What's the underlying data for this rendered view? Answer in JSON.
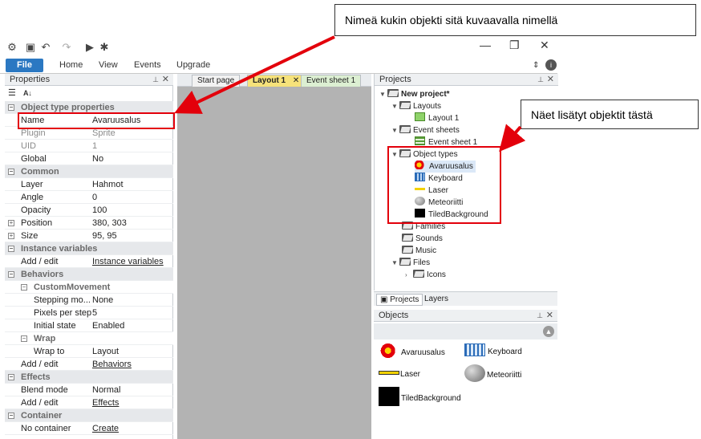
{
  "callouts": {
    "top": "Nimeä kukin objekti sitä kuvaavalla nimellä",
    "right": "Näet lisätyt objektit tästä"
  },
  "ribbon": {
    "file": "File",
    "home": "Home",
    "view": "View",
    "events": "Events",
    "upgrade": "Upgrade"
  },
  "properties": {
    "title": "Properties",
    "rows": [
      {
        "type": "cat",
        "label": "Object type properties"
      },
      {
        "label": "Name",
        "value": "Avaruusalus"
      },
      {
        "label": "Plugin",
        "value": "Sprite",
        "dim": true
      },
      {
        "label": "UID",
        "value": "1",
        "dim": true
      },
      {
        "label": "Global",
        "value": "No"
      },
      {
        "type": "cat",
        "label": "Common"
      },
      {
        "label": "Layer",
        "value": "Hahmot"
      },
      {
        "label": "Angle",
        "value": "0"
      },
      {
        "label": "Opacity",
        "value": "100"
      },
      {
        "label": "Position",
        "value": "380, 303",
        "expand": true
      },
      {
        "label": "Size",
        "value": "95, 95",
        "expand": true
      },
      {
        "type": "cat",
        "label": "Instance variables"
      },
      {
        "label": "Add / edit",
        "value": "Instance variables",
        "link": true
      },
      {
        "type": "cat",
        "label": "Behaviors"
      },
      {
        "type": "subcat",
        "label": "CustomMovement"
      },
      {
        "label": "Stepping mo...",
        "value": "None",
        "indent": true
      },
      {
        "label": "Pixels per step",
        "value": "5",
        "indent": true
      },
      {
        "label": "Initial state",
        "value": "Enabled",
        "indent": true
      },
      {
        "type": "subcat",
        "label": "Wrap"
      },
      {
        "label": "Wrap to",
        "value": "Layout",
        "indent": true
      },
      {
        "label": "Add / edit",
        "value": "Behaviors",
        "link": true
      },
      {
        "type": "cat",
        "label": "Effects"
      },
      {
        "label": "Blend mode",
        "value": "Normal"
      },
      {
        "label": "Add / edit",
        "value": "Effects",
        "link": true
      },
      {
        "type": "cat",
        "label": "Container"
      },
      {
        "label": "No container",
        "value": "Create",
        "link": true
      }
    ]
  },
  "doc_tabs": [
    "Start page",
    "Layout 1",
    "Event sheet 1"
  ],
  "projects": {
    "title": "Projects",
    "root": "New project*",
    "layouts": "Layouts",
    "layout1": "Layout 1",
    "event_sheets": "Event sheets",
    "event_sheet1": "Event sheet 1",
    "object_types": "Object types",
    "items": [
      "Avaruusalus",
      "Keyboard",
      "Laser",
      "Meteoriitti",
      "TiledBackground"
    ],
    "families": "Families",
    "sounds": "Sounds",
    "music": "Music",
    "files": "Files",
    "icons": "Icons"
  },
  "bottom_tabs": {
    "projects": "Projects",
    "layers": "Layers"
  },
  "objects": {
    "title": "Objects",
    "items": [
      "Avaruusalus",
      "Keyboard",
      "Laser",
      "Meteoriitti",
      "TiledBackground"
    ]
  },
  "colors": {
    "accent": "#2b78c2",
    "highlight": "#e3000b",
    "canvas": "#b3b3b3"
  }
}
